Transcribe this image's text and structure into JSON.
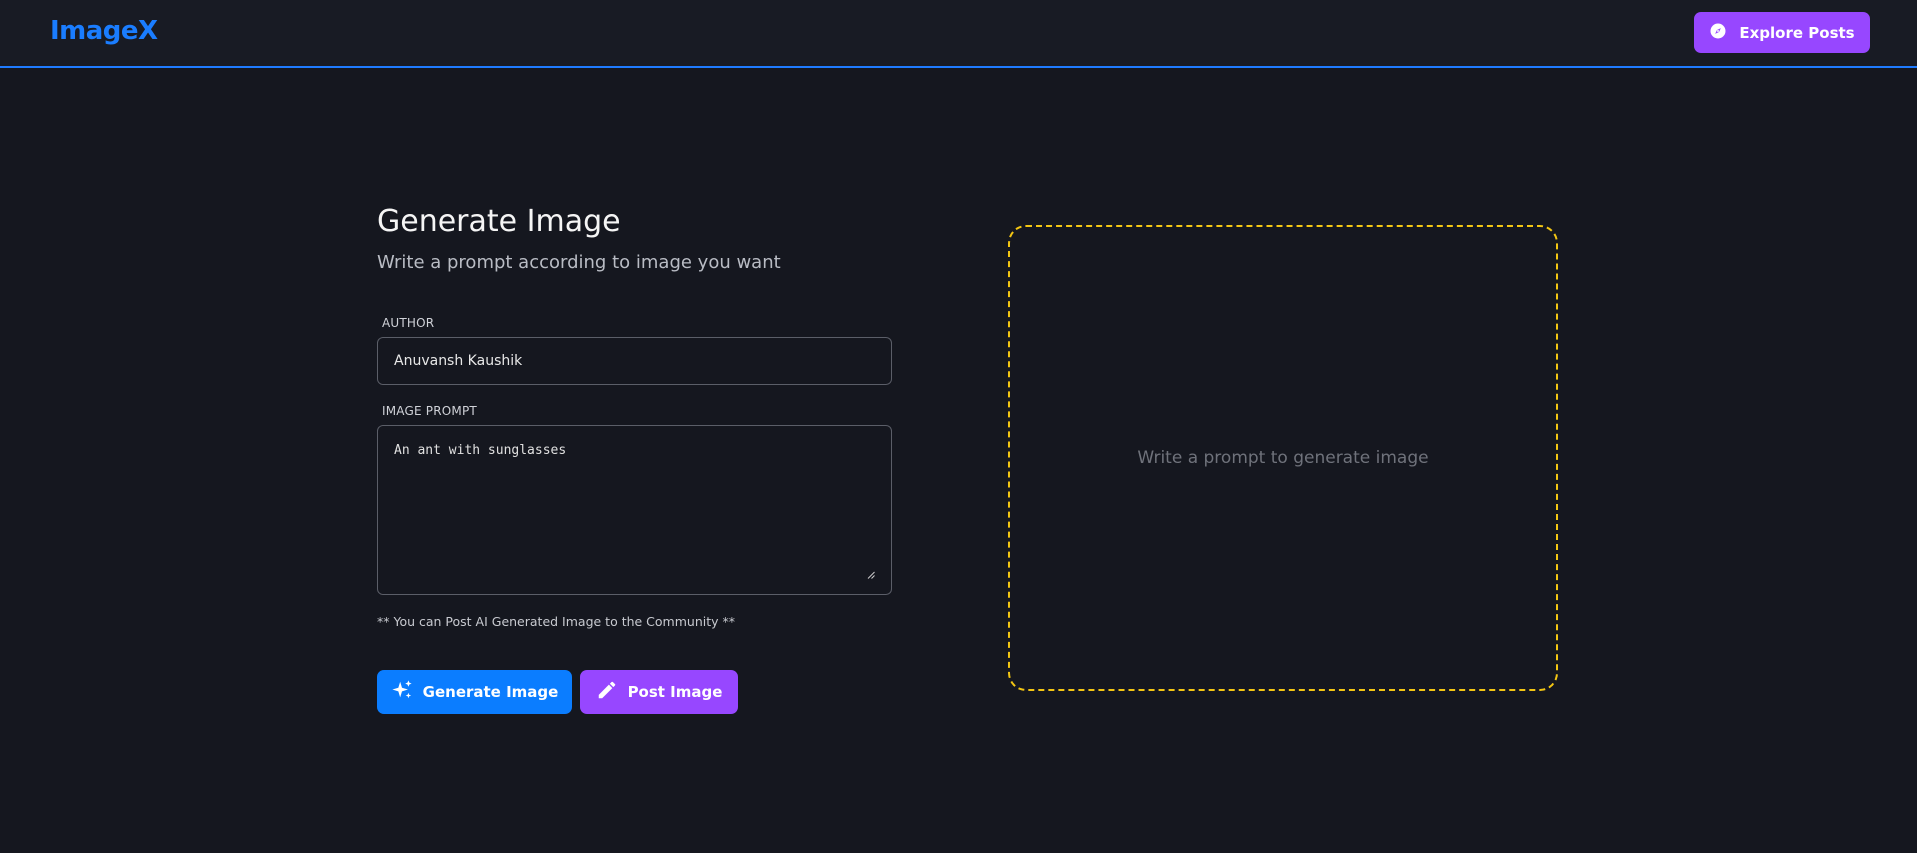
{
  "navbar": {
    "logo": "ImageX",
    "explore_label": "Explore Posts"
  },
  "form": {
    "title": "Generate Image",
    "subtitle": "Write a prompt according to image you want",
    "author_label": "AUTHOR",
    "author_value": "Anuvansh Kaushik",
    "prompt_label": "IMAGE PROMPT",
    "prompt_value": "An ant with sunglasses",
    "note": "** You can Post AI Generated Image to the Community **",
    "generate_label": "Generate Image",
    "post_label": "Post Image"
  },
  "preview": {
    "placeholder": "Write a prompt to generate image"
  },
  "colors": {
    "background": "#15171f",
    "brand_blue": "#1a7dff",
    "accent_purple": "#9747ff",
    "dashed_border": "#f3c613"
  }
}
